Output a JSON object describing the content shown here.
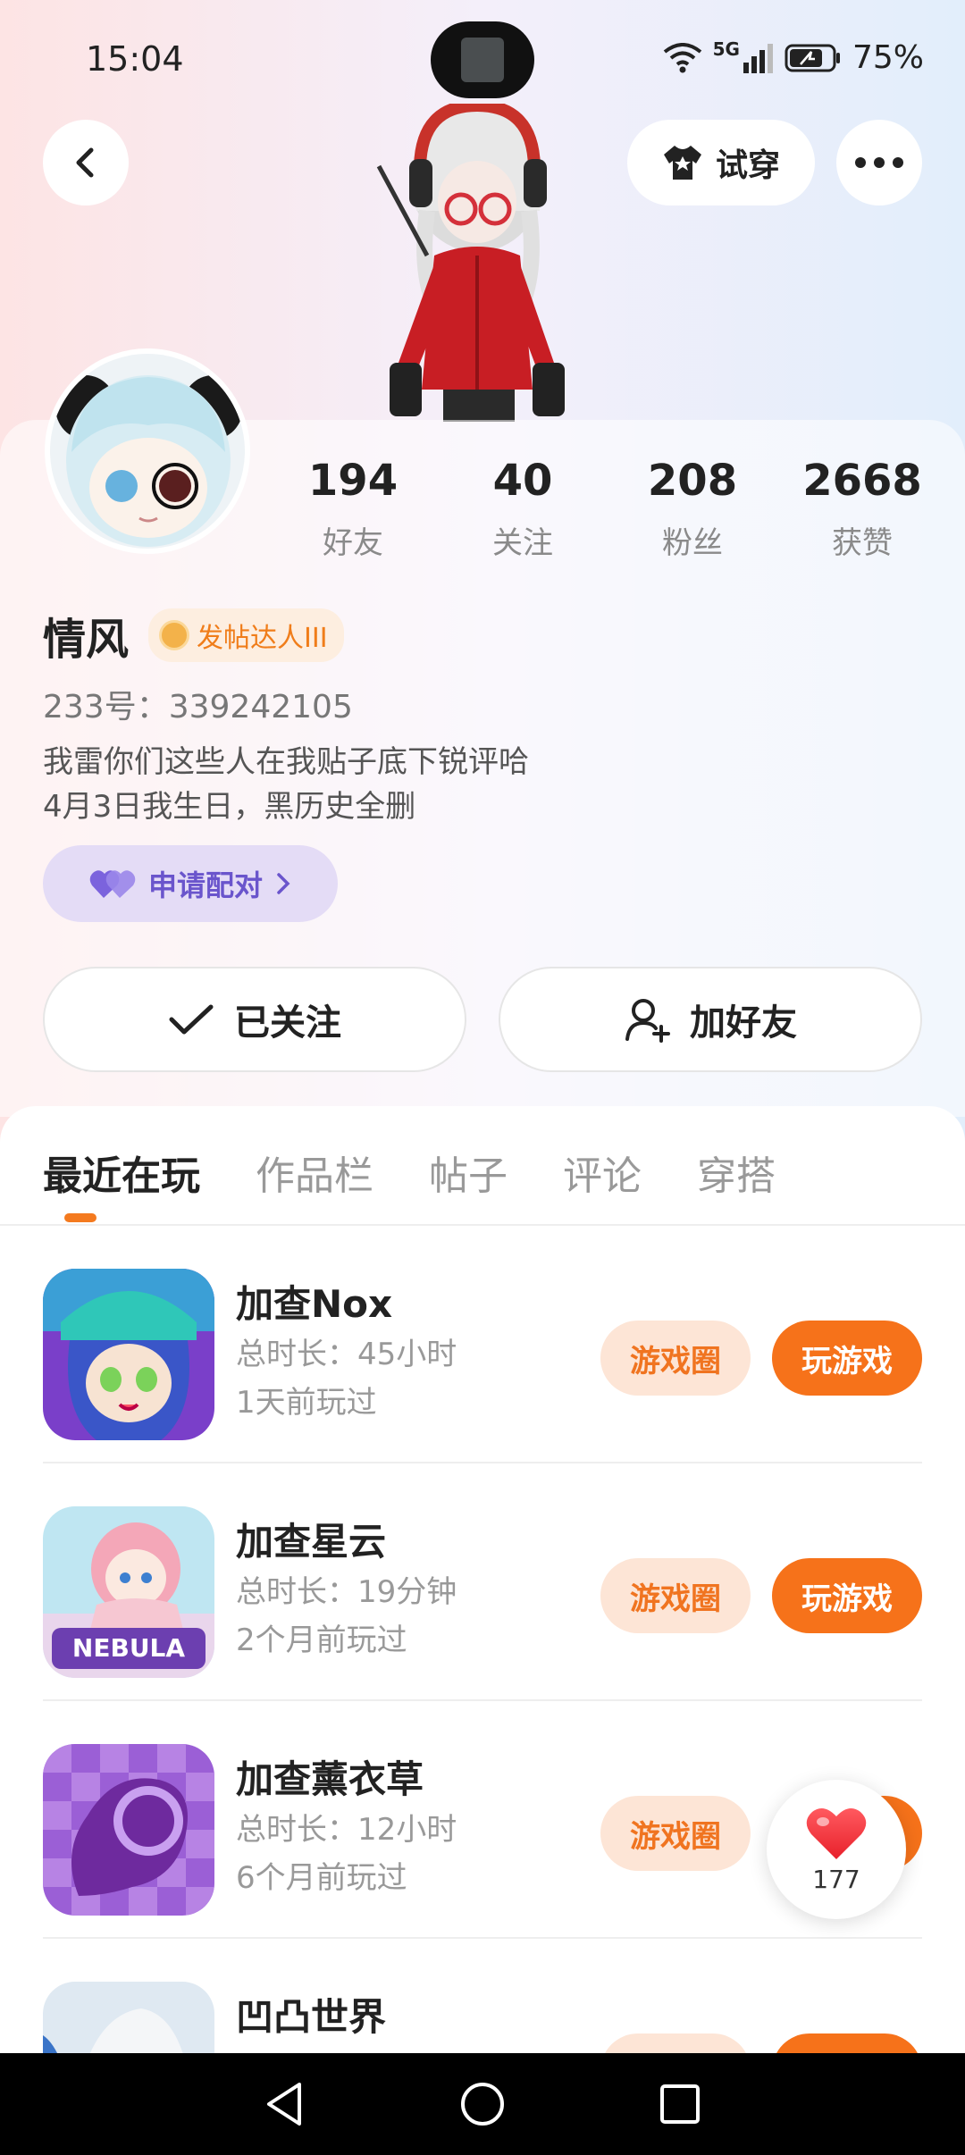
{
  "status_bar": {
    "time": "15:04",
    "network": "5G",
    "battery": "75%"
  },
  "header": {
    "try_on_label": "试穿"
  },
  "profile": {
    "name": "情风",
    "badge": "发帖达人III",
    "uid": "233号：339242105",
    "bio_line1": "我雷你们这些人在我贴子底下锐评哈",
    "bio_line2": "4月3日我生日，黑历史全删",
    "pair_label": "申请配对"
  },
  "stats": [
    {
      "value": "194",
      "label": "好友"
    },
    {
      "value": "40",
      "label": "关注"
    },
    {
      "value": "208",
      "label": "粉丝"
    },
    {
      "value": "2668",
      "label": "获赞"
    }
  ],
  "actions": {
    "follow_label": "已关注",
    "add_friend_label": "加好友"
  },
  "tabs": [
    "最近在玩",
    "作品栏",
    "帖子",
    "评论",
    "穿搭"
  ],
  "games": [
    {
      "name": "加查Nox",
      "duration": "总时长：45小时",
      "last_played": "1天前玩过",
      "circle_label": "游戏圈",
      "play_label": "玩游戏"
    },
    {
      "name": "加查星云",
      "duration": "总时长：19分钟",
      "last_played": "2个月前玩过",
      "circle_label": "游戏圈",
      "play_label": "玩游戏"
    },
    {
      "name": "加查薰衣草",
      "duration": "总时长：12小时",
      "last_played": "6个月前玩过",
      "circle_label": "游戏圈",
      "play_label": "玩游戏"
    },
    {
      "name": "凹凸世界",
      "duration": "",
      "last_played": "",
      "circle_label": "",
      "play_label": ""
    }
  ],
  "floating_like": {
    "count": "177"
  },
  "colors": {
    "accent": "#f6721a",
    "pair": "#6a55cc"
  },
  "icons": [
    "back-arrow-icon",
    "shirt-icon",
    "more-icon",
    "check-icon",
    "add-user-icon",
    "heart-icon",
    "nav-back-icon",
    "nav-home-icon",
    "nav-recent-icon"
  ]
}
